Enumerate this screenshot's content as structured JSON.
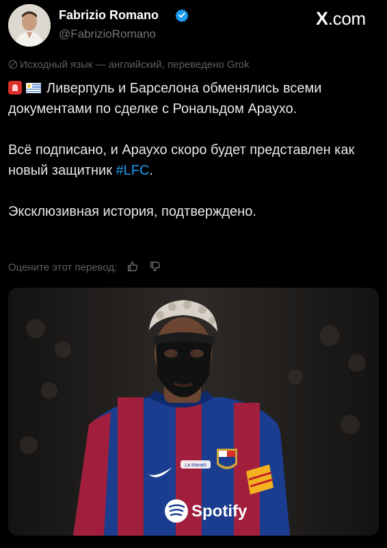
{
  "author": {
    "name": "Fabrizio Romano",
    "handle": "@FabrizioRomano",
    "verified": true
  },
  "site": {
    "brand": "X",
    "suffix": ".com"
  },
  "translation_note": "Исходный язык — английский, переведено Grok",
  "tweet": {
    "line1": "Ливерпуль и Барселона обменялись всеми документами по сделке с Рональдом Араухо.",
    "line2_text": "Всё подписано, и Араухо скоро будет представлен как новый защитник ",
    "hashtag": "#LFC",
    "line2_end": ".",
    "line3": "Эксклюзивная история, подтверждено."
  },
  "rate_prompt": "Оцените этот перевод:",
  "media": {
    "kit_sponsor": "Spotify",
    "sleeve_text": "La Marató"
  },
  "colors": {
    "background": "#000000",
    "text": "#e7e9ea",
    "muted": "#71767b",
    "accent": "#1d9bf0",
    "verified": "#1d9bf0"
  },
  "icons": [
    "verified-badge-icon",
    "globe-icon",
    "siren-emoji",
    "uruguay-flag-emoji",
    "thumbs-up-icon",
    "thumbs-down-icon"
  ]
}
